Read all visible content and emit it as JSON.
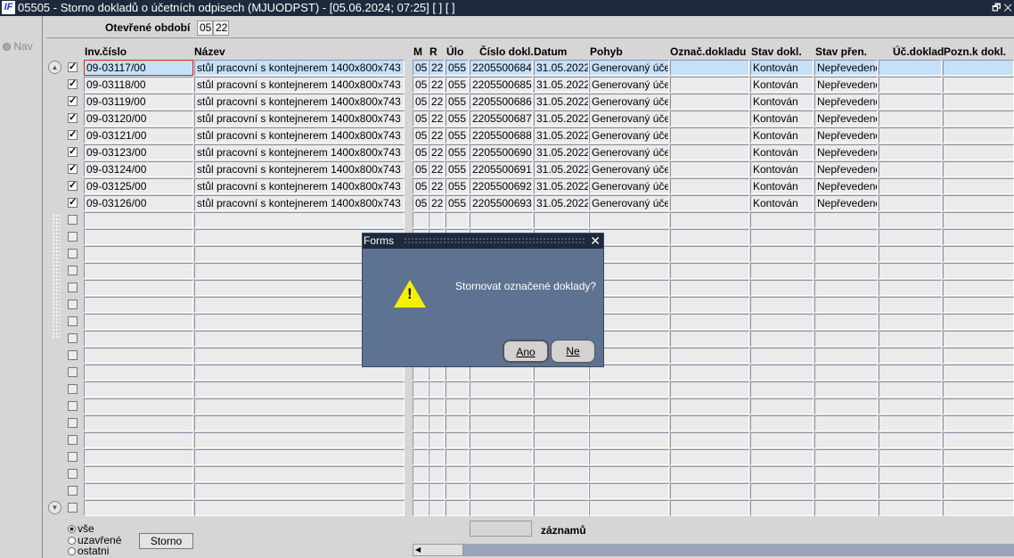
{
  "window": {
    "title": "05505 - Storno dokladů o účetních odpisech (MJUODPST) - [05.06.2024; 07:25]  [ ]  [ ]",
    "logo": "IF",
    "controls": "🗗 ✕"
  },
  "nav": {
    "label": "Nav"
  },
  "period": {
    "label": "Otevřené období",
    "month": "05",
    "year": "22"
  },
  "columns": [
    "Inv.číslo",
    "Název",
    "M",
    "R",
    "Úlo",
    "Číslo dokl.",
    "Datum",
    "Pohyb",
    "Označ.dokladu",
    "Stav dokl.",
    "Stav přen.",
    "Úč.doklad",
    "Pozn.k dokl."
  ],
  "rows": [
    {
      "checked": true,
      "inv": "09-03117/00",
      "nazev": "stůl pracovní s kontejnerem 1400x800x743",
      "m": "05",
      "r": "22",
      "ulo": "055",
      "cislo": "2205500684",
      "datum": "31.05.2022",
      "pohyb": "Generovaný účet",
      "oznac": "",
      "stav": "Kontován",
      "stav_pren": "Nepřevedeno",
      "uc_doklad": "",
      "pozn": ""
    },
    {
      "checked": true,
      "inv": "09-03118/00",
      "nazev": "stůl pracovní s kontejnerem 1400x800x743",
      "m": "05",
      "r": "22",
      "ulo": "055",
      "cislo": "2205500685",
      "datum": "31.05.2022",
      "pohyb": "Generovaný účet",
      "oznac": "",
      "stav": "Kontován",
      "stav_pren": "Nepřevedeno",
      "uc_doklad": "",
      "pozn": ""
    },
    {
      "checked": true,
      "inv": "09-03119/00",
      "nazev": "stůl pracovní s kontejnerem 1400x800x743",
      "m": "05",
      "r": "22",
      "ulo": "055",
      "cislo": "2205500686",
      "datum": "31.05.2022",
      "pohyb": "Generovaný účet",
      "oznac": "",
      "stav": "Kontován",
      "stav_pren": "Nepřevedeno",
      "uc_doklad": "",
      "pozn": ""
    },
    {
      "checked": true,
      "inv": "09-03120/00",
      "nazev": "stůl pracovní s kontejnerem 1400x800x743",
      "m": "05",
      "r": "22",
      "ulo": "055",
      "cislo": "2205500687",
      "datum": "31.05.2022",
      "pohyb": "Generovaný účet",
      "oznac": "",
      "stav": "Kontován",
      "stav_pren": "Nepřevedeno",
      "uc_doklad": "",
      "pozn": ""
    },
    {
      "checked": true,
      "inv": "09-03121/00",
      "nazev": "stůl pracovní s kontejnerem 1400x800x743",
      "m": "05",
      "r": "22",
      "ulo": "055",
      "cislo": "2205500688",
      "datum": "31.05.2022",
      "pohyb": "Generovaný účet",
      "oznac": "",
      "stav": "Kontován",
      "stav_pren": "Nepřevedeno",
      "uc_doklad": "",
      "pozn": ""
    },
    {
      "checked": true,
      "inv": "09-03123/00",
      "nazev": "stůl pracovní s kontejnerem 1400x800x743",
      "m": "05",
      "r": "22",
      "ulo": "055",
      "cislo": "2205500690",
      "datum": "31.05.2022",
      "pohyb": "Generovaný účet",
      "oznac": "",
      "stav": "Kontován",
      "stav_pren": "Nepřevedeno",
      "uc_doklad": "",
      "pozn": ""
    },
    {
      "checked": true,
      "inv": "09-03124/00",
      "nazev": "stůl pracovní s kontejnerem 1400x800x743",
      "m": "05",
      "r": "22",
      "ulo": "055",
      "cislo": "2205500691",
      "datum": "31.05.2022",
      "pohyb": "Generovaný účet",
      "oznac": "",
      "stav": "Kontován",
      "stav_pren": "Nepřevedeno",
      "uc_doklad": "",
      "pozn": ""
    },
    {
      "checked": true,
      "inv": "09-03125/00",
      "nazev": "stůl pracovní s kontejnerem 1400x800x743",
      "m": "05",
      "r": "22",
      "ulo": "055",
      "cislo": "2205500692",
      "datum": "31.05.2022",
      "pohyb": "Generovaný účet",
      "oznac": "",
      "stav": "Kontován",
      "stav_pren": "Nepřevedeno",
      "uc_doklad": "",
      "pozn": ""
    },
    {
      "checked": true,
      "inv": "09-03126/00",
      "nazev": "stůl pracovní s kontejnerem 1400x800x743",
      "m": "05",
      "r": "22",
      "ulo": "055",
      "cislo": "2205500693",
      "datum": "31.05.2022",
      "pohyb": "Generovaný účet",
      "oznac": "",
      "stav": "Kontován",
      "stav_pren": "Nepřevedeno",
      "uc_doklad": "",
      "pozn": ""
    }
  ],
  "filter": {
    "options": [
      {
        "label": "vše",
        "selected": true
      },
      {
        "label": "uzavřené",
        "selected": false
      },
      {
        "label": "ostatni",
        "selected": false
      }
    ]
  },
  "storno_label": "Storno",
  "records": {
    "value": "",
    "label": "záznamů"
  },
  "dialog": {
    "title": "Forms",
    "message": "Stornovat označené doklady?",
    "yes": "Ano",
    "no": "Ne",
    "close": "✕"
  }
}
